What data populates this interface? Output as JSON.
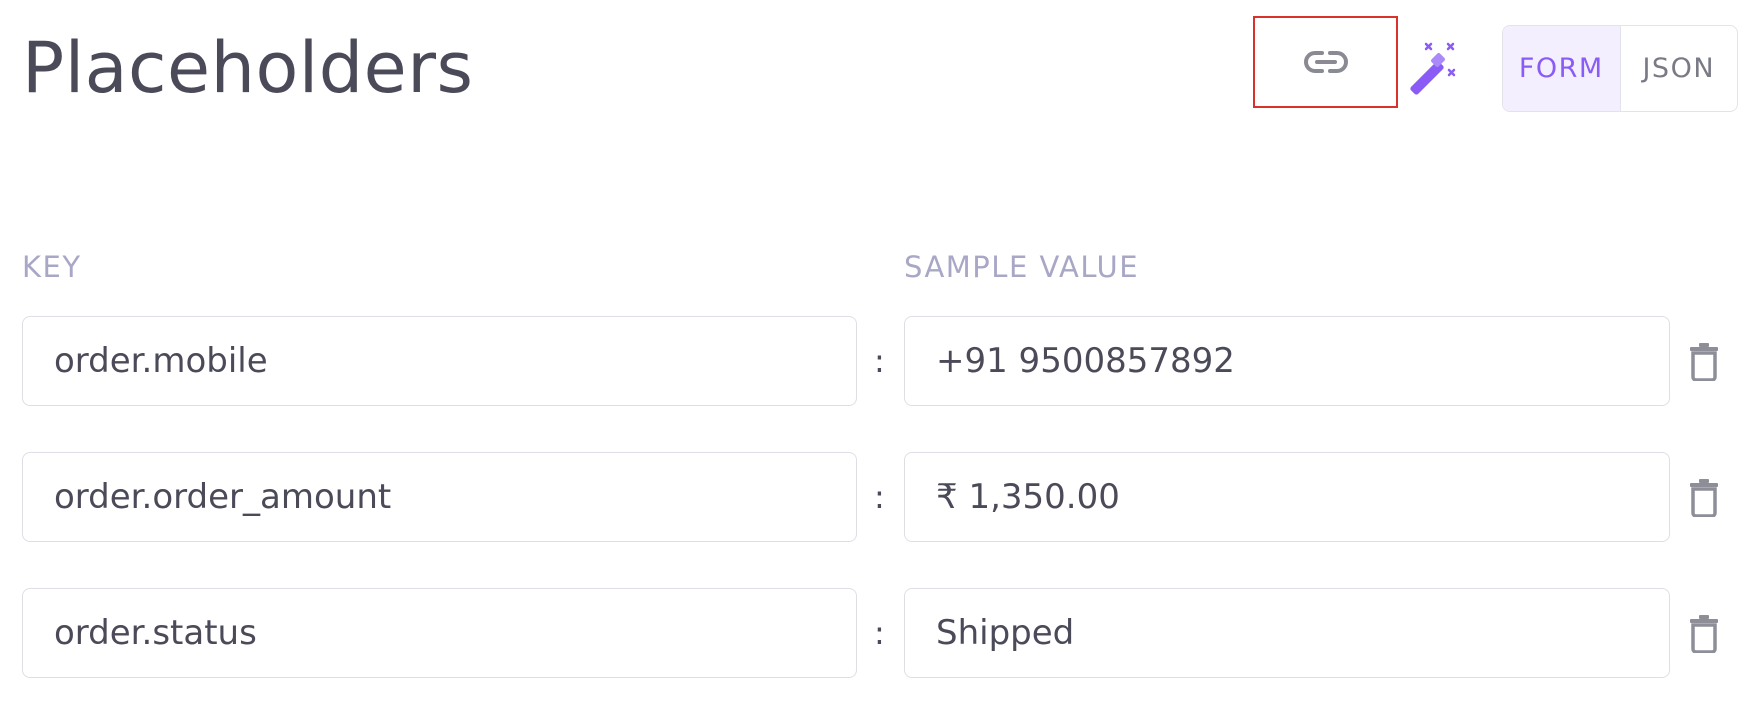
{
  "header": {
    "title": "Placeholders",
    "icons": {
      "link": "link-icon",
      "magic": "magic-wand-icon"
    },
    "view_toggle": {
      "options": [
        "FORM",
        "JSON"
      ],
      "selected": "FORM"
    }
  },
  "columns": {
    "key_label": "KEY",
    "value_label": "SAMPLE VALUE"
  },
  "rows": [
    {
      "key": "order.mobile",
      "separator": ":",
      "value": "+91 9500857892"
    },
    {
      "key": "order.order_amount",
      "separator": ":",
      "value": "₹ 1,350.00"
    },
    {
      "key": "order.status",
      "separator": ":",
      "value": "Shipped"
    }
  ],
  "colors": {
    "accent": "#8a5cf5",
    "accent_bg": "#f3efff",
    "title_text": "#4a4a59",
    "column_label": "#a9a7c6",
    "highlight_border": "#d9322b",
    "trash_icon": "#8e8e99"
  }
}
